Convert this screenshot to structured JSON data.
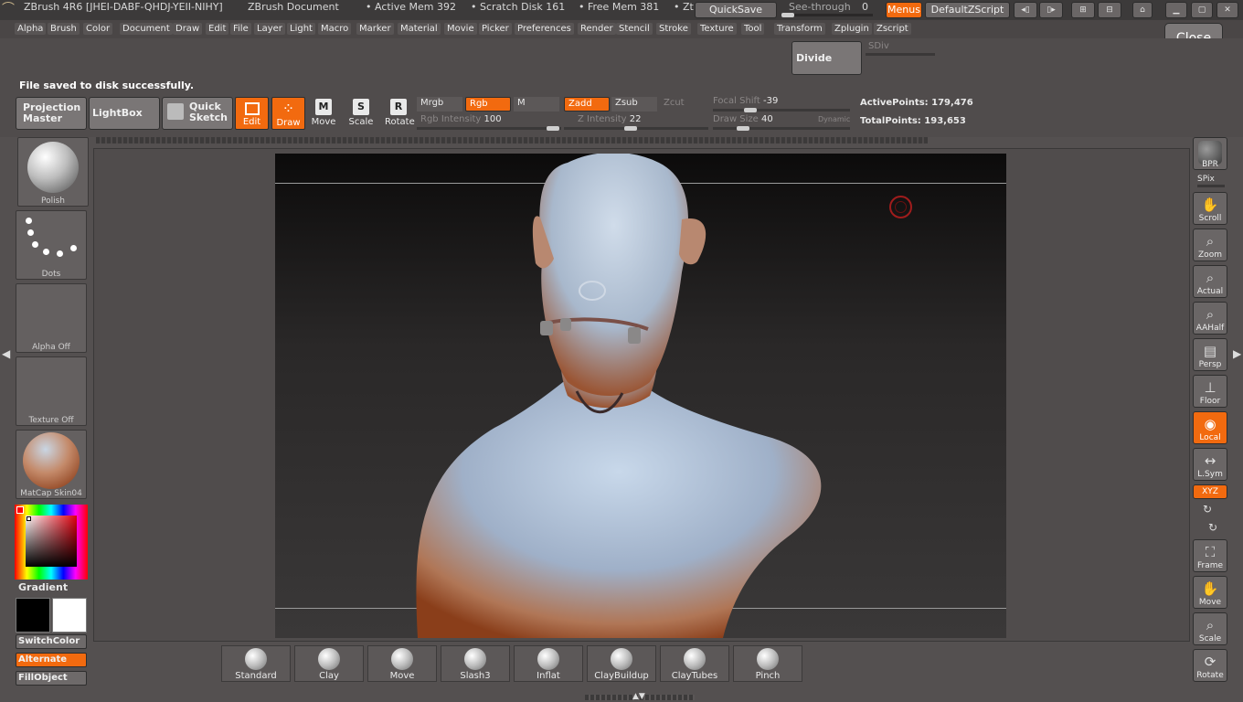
{
  "titlebar": {
    "app": "ZBrush 4R6 [JHEI-DABF-QHDJ-YEII-NIHY]",
    "doc": "ZBrush Document",
    "active_mem": "• Active Mem 392",
    "scratch": "• Scratch Disk 161",
    "free_mem": "• Free Mem 381",
    "zt": "• Zt",
    "quicksave": "QuickSave",
    "see_through_label": "See-through",
    "see_through_value": "0",
    "menus": "Menus",
    "default_zscript": "DefaultZScript"
  },
  "menus": [
    "Alpha",
    "Brush",
    "Color",
    "Document",
    "Draw",
    "Edit",
    "File",
    "Layer",
    "Light",
    "Macro",
    "Marker",
    "Material",
    "Movie",
    "Picker",
    "Preferences",
    "Render",
    "Stencil",
    "Stroke",
    "Texture",
    "Tool",
    "Transform",
    "Zplugin",
    "Zscript"
  ],
  "close_label": "Close",
  "divide": {
    "label": "Divide",
    "sdiv": "SDiv"
  },
  "status_message": "File saved to disk successfully.",
  "top": {
    "projection_master": [
      "Projection",
      "Master"
    ],
    "lightbox": "LightBox",
    "quick_sketch": [
      "Quick",
      "Sketch"
    ],
    "edit": "Edit",
    "draw": "Draw",
    "move": "Move",
    "scale": "Scale",
    "rotate": "Rotate",
    "mrgb": "Mrgb",
    "rgb": "Rgb",
    "m": "M",
    "zadd": "Zadd",
    "zsub": "Zsub",
    "zcut": "Zcut",
    "rgb_intensity_label": "Rgb  Intensity",
    "rgb_intensity_value": "100",
    "z_intensity_label": "Z  Intensity",
    "z_intensity_value": "22",
    "focal_shift_label": "Focal  Shift",
    "focal_shift_value": "-39",
    "draw_size_label": "Draw  Size",
    "draw_size_value": "40",
    "dynamic": "Dynamic",
    "active_points_label": "ActivePoints:",
    "active_points_value": "179,476",
    "total_points_label": "TotalPoints:",
    "total_points_value": "193,653"
  },
  "left_shelf": {
    "brush": "Polish",
    "stroke": "Dots",
    "alpha": "Alpha  Off",
    "texture": "Texture  Off",
    "material": "MatCap  Skin04",
    "gradient": "Gradient",
    "switch_color": "SwitchColor",
    "alternate": "Alternate",
    "fill_object": "FillObject"
  },
  "right_shelf": [
    {
      "name": "bpr",
      "label": "BPR"
    },
    {
      "name": "spix",
      "label": "SPix"
    },
    {
      "name": "scroll",
      "label": "Scroll"
    },
    {
      "name": "zoom",
      "label": "Zoom"
    },
    {
      "name": "actual",
      "label": "Actual"
    },
    {
      "name": "aahalf",
      "label": "AAHalf"
    },
    {
      "name": "persp",
      "label": "Persp"
    },
    {
      "name": "floor",
      "label": "Floor"
    },
    {
      "name": "local",
      "label": "Local"
    },
    {
      "name": "lsym",
      "label": "L.Sym"
    },
    {
      "name": "xyz",
      "label": "XYZ"
    },
    {
      "name": "frame",
      "label": "Frame"
    },
    {
      "name": "move",
      "label": "Move"
    },
    {
      "name": "scale",
      "label": "Scale"
    },
    {
      "name": "rotate",
      "label": "Rotate"
    }
  ],
  "brushes": [
    "Standard",
    "Clay",
    "Move",
    "Slash3",
    "Inflat",
    "ClayBuildup",
    "ClayTubes",
    "Pinch"
  ],
  "colors": {
    "accent": "#f26a0f",
    "panel": "#545050",
    "skin_shadow": "#b06436",
    "skin_light": "#b8c8da"
  }
}
